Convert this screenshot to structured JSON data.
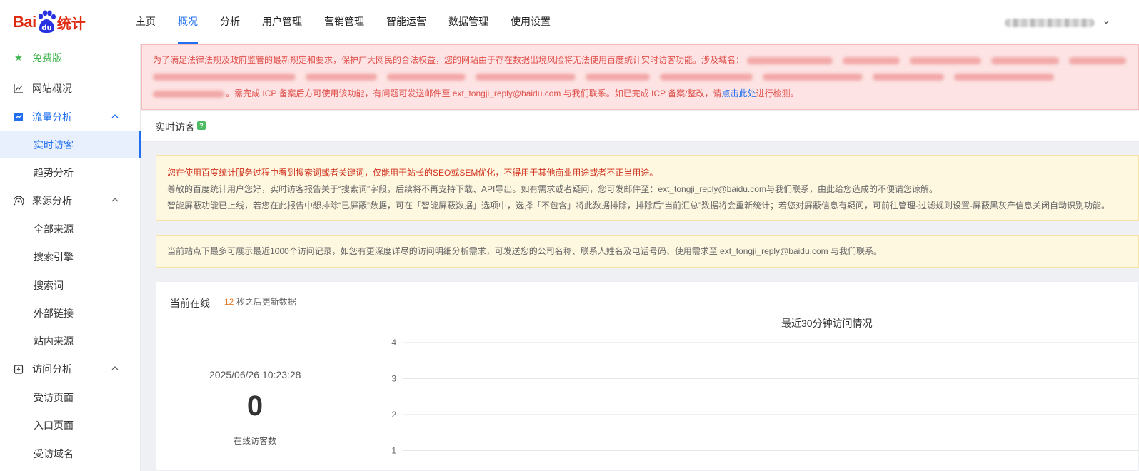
{
  "brand": {
    "bai": "Bai",
    "du": "du",
    "tongji": "统计"
  },
  "nav": {
    "items": [
      "主页",
      "概况",
      "分析",
      "用户管理",
      "营销管理",
      "智能运营",
      "数据管理",
      "使用设置"
    ],
    "active_index": 1
  },
  "user": {
    "chevron": "⌄"
  },
  "sidebar": {
    "free": "免费版",
    "overview": "网站概况",
    "traffic": "流量分析",
    "traffic_items": [
      "实时访客",
      "趋势分析"
    ],
    "source": "来源分析",
    "source_items": [
      "全部来源",
      "搜索引擎",
      "搜索词",
      "外部链接",
      "站内来源"
    ],
    "visit": "访问分析",
    "visit_items": [
      "受访页面",
      "入口页面",
      "受访域名"
    ]
  },
  "alert": {
    "line1": "为了满足法律法规及政府监管的最新规定和要求，保护广大网民的合法权益，您的网站由于存在数据出境风险将无法使用百度统计实时访客功能。涉及域名：",
    "line3_before": "。需完成 ICP 备案后方可使用该功能，有问题可发送邮件至 ext_tongji_reply@baidu.com 与我们联系。如已完成 ICP 备案/整改，请",
    "link": "点击此处",
    "line3_after": "进行检测。"
  },
  "page": {
    "title": "实时访客",
    "help": "?"
  },
  "notice": {
    "line1": "您在使用百度统计服务过程中看到搜索词或者关键词，仅能用于站长的SEO或SEM优化，不得用于其他商业用途或者不正当用途。",
    "line2": "尊敬的百度统计用户您好，实时访客报告关于“搜索词”字段，后续将不再支持下载、API导出。如有需求或者疑问，您可发邮件至：ext_tongji_reply@baidu.com与我们联系，由此给您造成的不便请您谅解。",
    "line3": "智能屏蔽功能已上线，若您在此报告中想排除“已屏蔽”数据，可在「智能屏蔽数据」选项中，选择「不包含」将此数据排除，排除后“当前汇总”数据将会重新统计；若您对屏蔽信息有疑问，可前往管理-过滤规则设置-屏蔽黑灰产信息关闭自动识别功能。",
    "line4": "当前站点下最多可展示最近1000个访问记录，如您有更深度详尽的访问明细分析需求，可发送您的公司名称、联系人姓名及电话号码、使用需求至 ext_tongji_reply@baidu.com 与我们联系。"
  },
  "online": {
    "title": "当前在线",
    "countdown": "12",
    "countdown_suffix": "秒之后更新数据",
    "timestamp": "2025/06/26 10:23:28",
    "count": "0",
    "caption": "在线访客数"
  },
  "chart_data": {
    "type": "line",
    "title": "最近30分钟访问情况",
    "y_ticks": [
      "4",
      "3",
      "2",
      "1"
    ],
    "ylim": [
      0,
      4
    ],
    "series": [],
    "grid": true
  }
}
